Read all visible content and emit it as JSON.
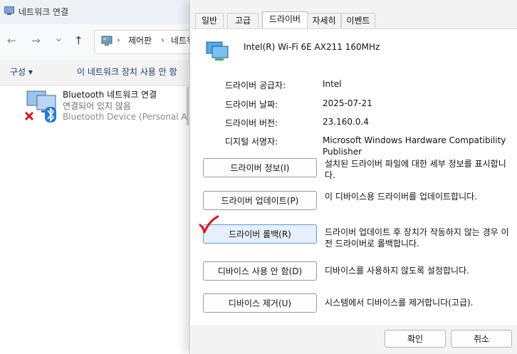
{
  "explorer": {
    "window_title": "네트워크 연결",
    "nav": {
      "back": "←",
      "forward": "→",
      "down": "⌄",
      "up": "↑"
    },
    "address": {
      "sep": "›",
      "control_panel": "제어판",
      "network": "네트워"
    },
    "toolbar": {
      "organize": "구성 ▾",
      "disable_device": "이 네트워크 장치 사용 안 함"
    },
    "item": {
      "name": "Bluetooth 네트워크 연결",
      "status": "연결되어 있지 않음",
      "device": "Bluetooth Device (Personal A..."
    }
  },
  "dialog": {
    "tabs": [
      "일반",
      "고급",
      "드라이버",
      "자세히",
      "이벤트"
    ],
    "active_tab_index": 2,
    "device_name": "Intel(R) Wi-Fi 6E AX211 160MHz",
    "properties": [
      {
        "label": "드라이버 공급자:",
        "value": "Intel"
      },
      {
        "label": "드라이버 날짜:",
        "value": "2025-07-21"
      },
      {
        "label": "드라이버 버전:",
        "value": "23.160.0.4"
      },
      {
        "label": "디지털 서명자:",
        "value": "Microsoft Windows Hardware Compatibility Publisher"
      }
    ],
    "actions": [
      {
        "label": "드라이버 정보(I)",
        "desc": "설치된 드라이버 파일에 대한 세부 정보를 표시합니다."
      },
      {
        "label": "드라이버 업데이트(P)",
        "desc": "이 디바이스용 드라이버를 업데이트합니다."
      },
      {
        "label": "드라이버 롤백(R)",
        "desc": "드라이버 업데이트 후 장치가 작동하지 않는 경우 이전 드라이버로 롤백합니다."
      },
      {
        "label": "디바이스 사용 안 함(D)",
        "desc": "디바이스를 사용하지 않도록 설정합니다."
      },
      {
        "label": "디바이스 제거(U)",
        "desc": "시스템에서 디바이스를 제거합니다(고급)."
      }
    ],
    "ok_label": "확인",
    "cancel_label": "취소"
  },
  "colors": {
    "focused_button_border": "#5a9ad9",
    "annotation_check": "#e0141e",
    "link_blue": "#1f3a6e"
  }
}
